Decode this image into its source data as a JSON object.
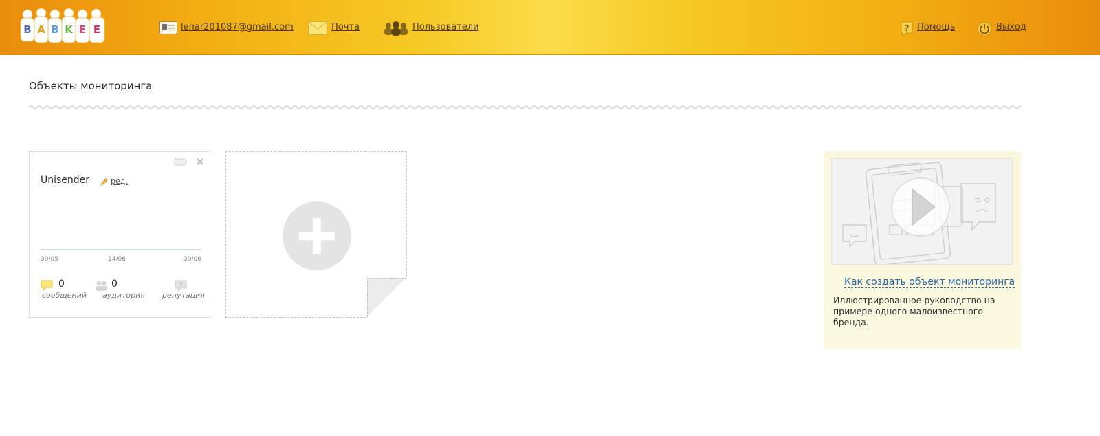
{
  "header": {
    "logo_text": "BABKEE",
    "email": "lenar201087@gmail.com",
    "mail_label": "Почта",
    "users_label": "Пользователи",
    "help_label": "Помощь",
    "logout_label": "Выход"
  },
  "page": {
    "title": "Объекты мониторинга"
  },
  "card": {
    "name": "Unisender",
    "edit_label": "ред.",
    "dates": [
      "30/05",
      "14/06",
      "30/06"
    ],
    "stats": [
      {
        "value": "0",
        "label": "сообщений",
        "icon": "chat-bubble-icon"
      },
      {
        "value": "0",
        "label": "аудитория",
        "icon": "people-icon"
      },
      {
        "value": "",
        "label": "репутация",
        "icon": "question-bubble-icon"
      }
    ]
  },
  "help": {
    "link": "Как создать объект мониторинга",
    "description": "Иллюстрированное руководство на примере одного малоизвестного бренда."
  },
  "colors": {
    "header_edge": "#ea8c0c",
    "header_center": "#fbdc4a",
    "link_blue": "#2a6ca8",
    "help_bg": "#fbf8e0"
  }
}
